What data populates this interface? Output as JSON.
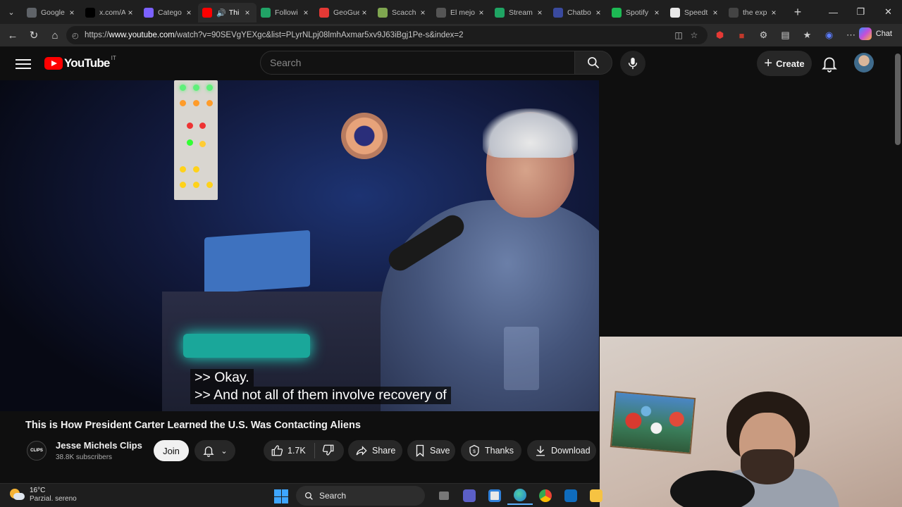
{
  "browser": {
    "tabs": [
      {
        "title": "Google",
        "color": "#5f6368",
        "active": false,
        "audio": false
      },
      {
        "title": "x.com/A",
        "color": "#000000",
        "active": false,
        "audio": false
      },
      {
        "title": "Catego",
        "color": "#7b61ff",
        "active": false,
        "audio": false
      },
      {
        "title": "Thi",
        "color": "#ff0000",
        "active": true,
        "audio": true
      },
      {
        "title": "Followi",
        "color": "#21a366",
        "active": false,
        "audio": false
      },
      {
        "title": "GeoGue",
        "color": "#e53935",
        "active": false,
        "audio": false
      },
      {
        "title": "Scacch",
        "color": "#7fa650",
        "active": false,
        "audio": false
      },
      {
        "title": "El mejo",
        "color": "#555555",
        "active": false,
        "audio": false
      },
      {
        "title": "Stream",
        "color": "#1fa463",
        "active": false,
        "audio": false
      },
      {
        "title": "Chatbo",
        "color": "#3a4a9e",
        "active": false,
        "audio": false
      },
      {
        "title": "Spotify",
        "color": "#1db954",
        "active": false,
        "audio": false
      },
      {
        "title": "Speedt",
        "color": "#e8e8e8",
        "active": false,
        "audio": false
      },
      {
        "title": "the exp",
        "color": "#444444",
        "active": false,
        "audio": false
      }
    ],
    "new_tab": "+",
    "url_prefix": "https://",
    "url_host": "www.youtube.com",
    "url_rest": "/watch?v=90SEVgYEXgc&list=PLyrNLpj08lmhAxmar5xv9J63iBgj1Pe-s&index=2",
    "chat_label": "Chat"
  },
  "youtube": {
    "logo_text": "YouTube",
    "region": "IT",
    "search_placeholder": "Search",
    "create_label": "Create"
  },
  "video": {
    "caption_line1": ">> Okay.",
    "caption_line2": ">> And not all of them involve recovery of",
    "title": "This is How President Carter Learned the U.S. Was Contacting Aliens"
  },
  "channel": {
    "name": "Jesse Michels Clips",
    "subscribers": "38.8K subscribers",
    "avatar_text": "CLIPS",
    "join_label": "Join"
  },
  "actions": {
    "likes": "1.7K",
    "share": "Share",
    "save": "Save",
    "thanks": "Thanks",
    "download": "Download"
  },
  "taskbar": {
    "temperature": "16°C",
    "condition": "Parzial. sereno",
    "search_label": "Search"
  }
}
